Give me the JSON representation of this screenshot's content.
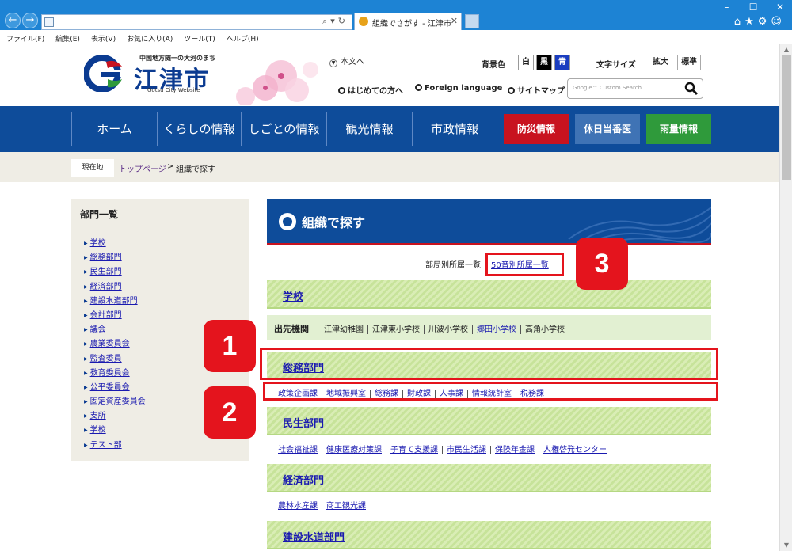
{
  "browser": {
    "tab_title": "組織でさがす - 江津市",
    "menu": [
      "ファイル(F)",
      "編集(E)",
      "表示(V)",
      "お気に入り(A)",
      "ツール(T)",
      "ヘルプ(H)"
    ]
  },
  "header": {
    "catch": "中国地方随一の大河のまち",
    "city_name": "江津市",
    "city_roman": "Gotsu City Website",
    "skip_link": "本文へ",
    "bg_label": "背景色",
    "bg_options": [
      "白",
      "黒",
      "青"
    ],
    "fontsize_label": "文字サイズ",
    "fontsize_options": [
      "拡大",
      "標準"
    ],
    "util_links": [
      "はじめての方へ",
      "Foreign language",
      "サイトマップ"
    ],
    "search_placeholder": "Google™ Custom Search"
  },
  "nav": {
    "items": [
      "ホーム",
      "くらしの情報",
      "しごとの情報",
      "観光情報",
      "市政情報"
    ],
    "boxes": [
      {
        "label": "防災情報",
        "color": "#c8131f"
      },
      {
        "label": "休日当番医",
        "color": "#3f73b5"
      },
      {
        "label": "雨量情報",
        "color": "#2f9a3b"
      }
    ]
  },
  "breadcrumb": {
    "here": "現在地",
    "top": "トップページ",
    "sep": ">",
    "current": "組織で探す"
  },
  "sidebar": {
    "title": "部門一覧",
    "items": [
      "学校",
      "総務部門",
      "民生部門",
      "経済部門",
      "建設水道部門",
      "会計部門",
      "議会",
      "農業委員会",
      "監査委員",
      "教育委員会",
      "公平委員会",
      "固定資産委員会",
      "支所",
      "学校",
      "テスト部"
    ]
  },
  "main": {
    "title": "組織で探す",
    "kana_label": "部局別所属一覧",
    "kana_link": "50音別所属一覧",
    "sections": {
      "school": "学校",
      "somu": "総務部門",
      "minsei": "民生部門",
      "keizai": "経済部門",
      "kensetsu": "建設水道部門"
    },
    "satellite_label": "出先機関",
    "satellite_items": [
      "江津幼稚園",
      "江津東小学校",
      "川波小学校",
      "郷田小学校",
      "高角小学校"
    ],
    "somu_links": [
      "政策企画課",
      "地域振興室",
      "総務課",
      "財政課",
      "人事課",
      "情報統計室",
      "税務課"
    ],
    "minsei_links": [
      "社会福祉課",
      "健康医療対策課",
      "子育て支援課",
      "市民生活課",
      "保険年金課",
      "人権啓発センター"
    ],
    "keizai_links": [
      "農林水産課",
      "商工観光課"
    ]
  },
  "annotations": [
    "1",
    "2",
    "3"
  ],
  "colors": {
    "accent_red": "#e4141d",
    "nav_blue": "#0e4c9a",
    "section_green": "#c7e39a"
  }
}
